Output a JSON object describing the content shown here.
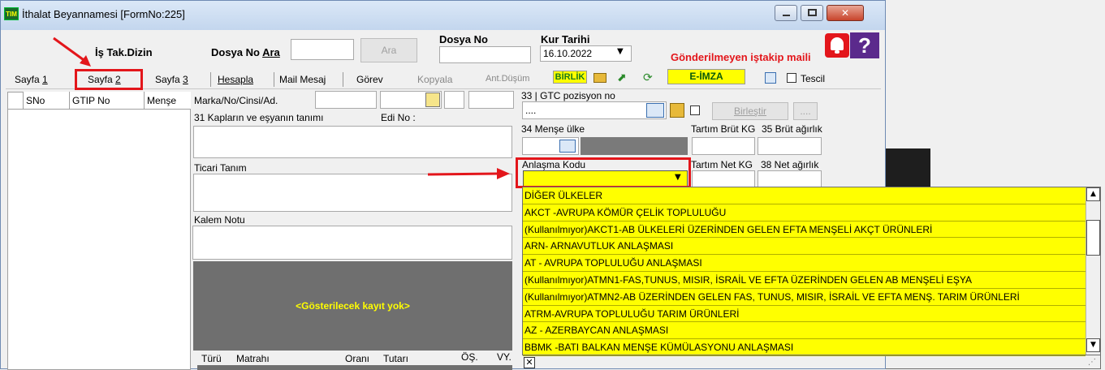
{
  "window": {
    "title": "İthalat Beyannamesi [FormNo:225]"
  },
  "header": {
    "is_tak_dizin": "İş Tak.Dizin",
    "dosya_no_ara_label": "Dosya No ",
    "dosya_no_ara_underline": "Ara",
    "ara_button": "Ara",
    "dosya_no_label": "Dosya No",
    "kur_tarihi_label": "Kur Tarihi",
    "kur_tarihi_value": "16.10.2022",
    "notice": "Gönderilmeyen iştakip maili"
  },
  "tabs": [
    {
      "label": "Sayfa ",
      "ul": "1"
    },
    {
      "label": "Sayfa ",
      "ul": "2"
    },
    {
      "label": "Sayfa ",
      "ul": "3"
    }
  ],
  "toolbar": {
    "hesapla": "Hesapla",
    "mail_mesaj": "Mail Mesaj",
    "gorev": "Görev",
    "kopyala": "Kopyala",
    "ant_dusum": "Ant.Düşüm",
    "birlik": "BİRLİK",
    "e_imza": "E-İMZA",
    "tescil": "Tescil"
  },
  "grid": {
    "columns": [
      "SNo",
      "GTIP No",
      "Menşe"
    ]
  },
  "form": {
    "marka_label": "Marka/No/Cinsi/Ad.",
    "kaplar_label": "31 Kapların ve eşyanın tanımı",
    "edi_no_label": "Edi No :",
    "ticari_tanim_label": "Ticari Tanım",
    "kalem_notu_label": "Kalem Notu",
    "no_records": "<Gösterilecek kayıt yok>",
    "bottom_headers": [
      "Türü",
      "Matrahı",
      "Oranı",
      "Tutarı",
      "ÖŞ.",
      "VY."
    ],
    "gtc_label": "33 | GTC pozisyon no",
    "gtc_value": "....",
    "birlestir": "Birleştir",
    "ellipsis": "....",
    "mense_ulke_label": "34 Menşe ülke",
    "tartim_brut_label": "Tartım Brüt KG",
    "brut_agirlik_label": "35 Brüt ağırlık",
    "anlasma_kodu_label": "Anlaşma Kodu",
    "tartim_net_label": "Tartım Net KG",
    "net_agirlik_label": "38 Net ağırlık"
  },
  "dropdown": {
    "items": [
      "DİĞER ÜLKELER",
      "AKCT -AVRUPA KÖMÜR ÇELİK TOPLULUĞU",
      "(Kullanılmıyor)AKCT1-AB ÜLKELERİ ÜZERİNDEN GELEN EFTA MENŞELİ AKÇT ÜRÜNLERİ",
      "ARN- ARNAVUTLUK ANLAŞMASI",
      "AT    - AVRUPA TOPLULUĞU ANLAŞMASI",
      "(Kullanılmıyor)ATMN1-FAS,TUNUS, MISIR, İSRAİL VE EFTA ÜZERİNDEN GELEN AB MENŞELİ EŞYA",
      "(Kullanılmıyor)ATMN2-AB ÜZERİNDEN GELEN FAS, TUNUS, MISIR, İSRAİL VE EFTA MENŞ. TARIM ÜRÜNLERİ",
      "ATRM-AVRUPA TOPLULUĞU TARIM ÜRÜNLERİ",
      "AZ - AZERBAYCAN ANLAŞMASI",
      "BBMK -BATI BALKAN MENŞE KÜMÜLASYONU ANLAŞMASI"
    ]
  },
  "colors": {
    "highlight": "#e3161b",
    "dropdown_bg": "#ffff00"
  },
  "icons": [
    "app-icon",
    "alarm-bell-icon",
    "help-icon",
    "minimize-icon",
    "maximize-icon",
    "close-icon",
    "edit-icon",
    "folder-icon",
    "export-icon",
    "refresh-icon",
    "grid-icon",
    "box-icon"
  ]
}
